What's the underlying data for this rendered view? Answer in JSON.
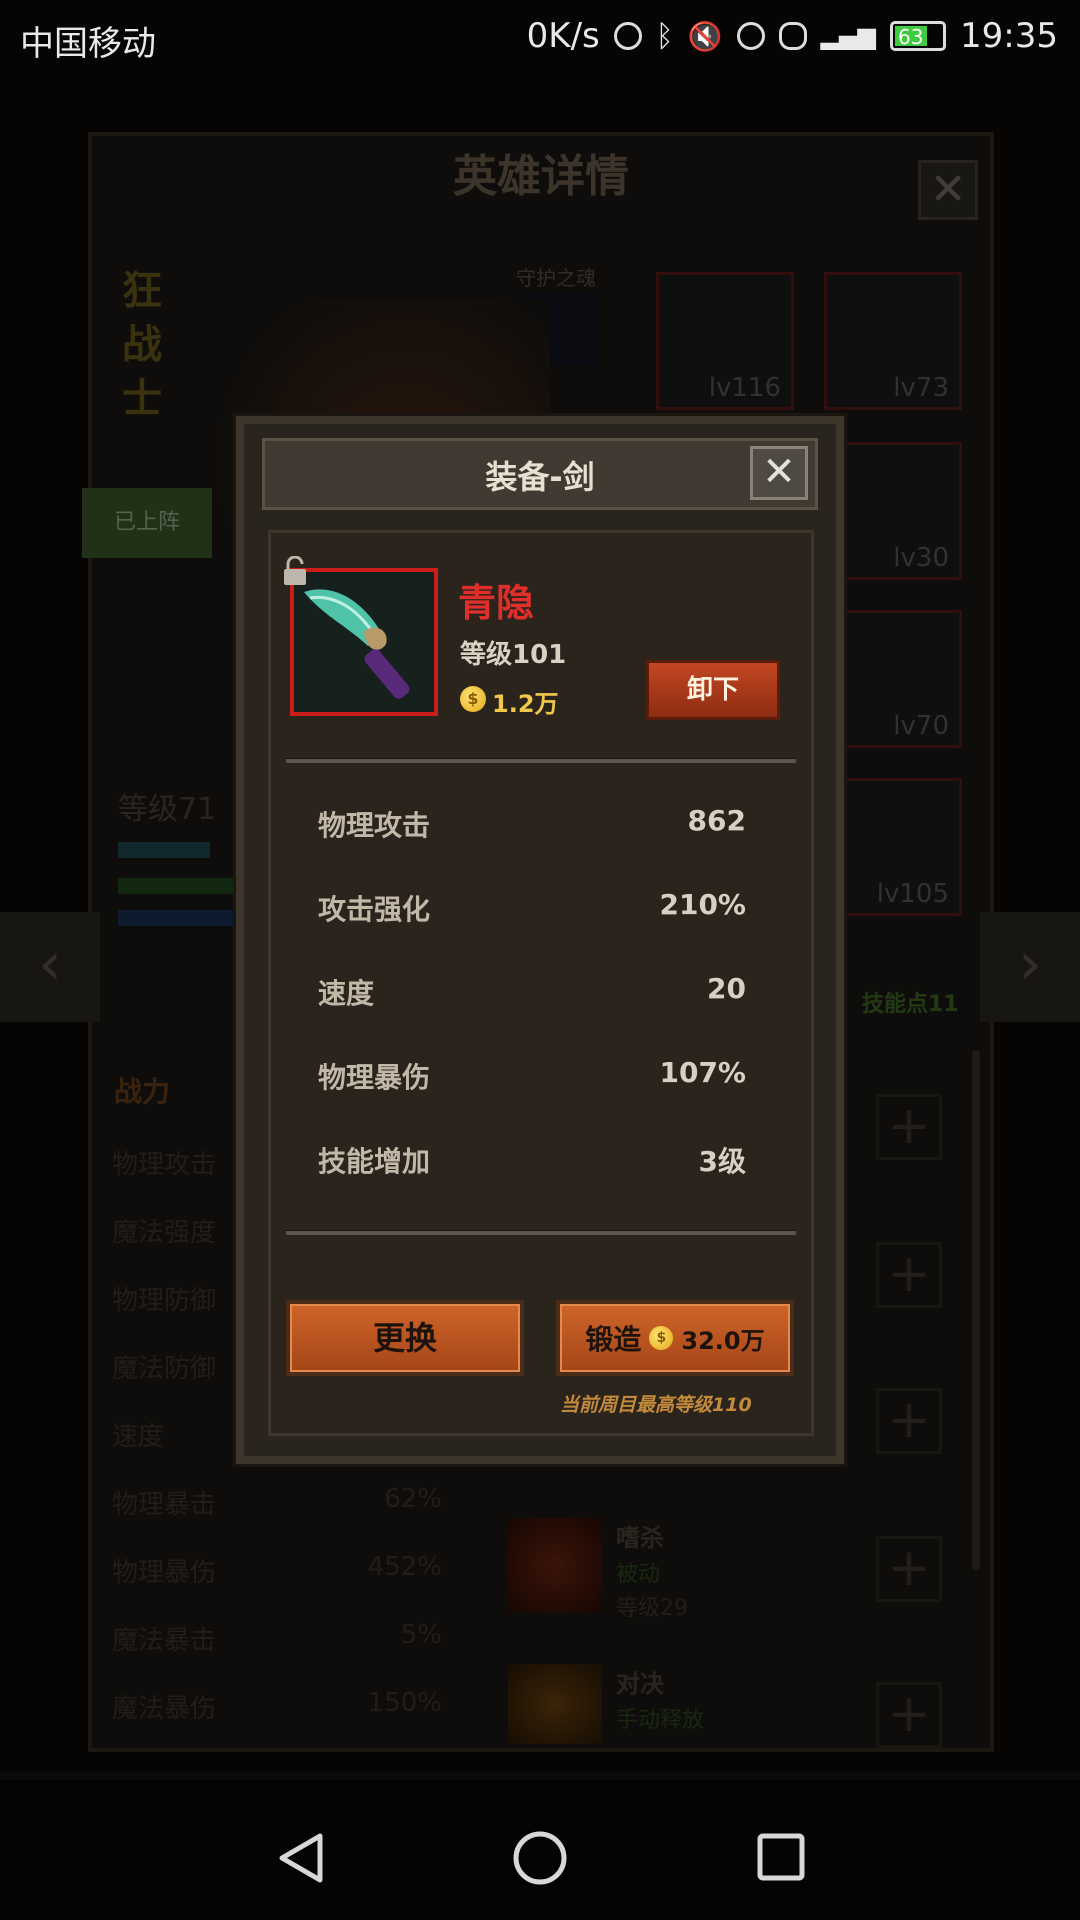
{
  "status_bar": {
    "carrier": "中国移动",
    "network_speed": "0K/s",
    "battery": "63",
    "time": "19:35"
  },
  "background": {
    "title": "英雄详情",
    "hero_name": "狂战士",
    "soul_label": "守护之魂",
    "deployed_badge": "已上阵",
    "hero_level": "等级71",
    "skill_points": "技能点11",
    "equipment_levels": [
      "lv116",
      "lv73",
      "lv30",
      "lv70",
      "lv105"
    ],
    "stats_title": "战力",
    "stats": [
      {
        "label": "物理攻击",
        "value": ""
      },
      {
        "label": "魔法强度",
        "value": ""
      },
      {
        "label": "物理防御",
        "value": ""
      },
      {
        "label": "魔法防御",
        "value": ""
      },
      {
        "label": "速度",
        "value": ""
      },
      {
        "label": "物理暴击",
        "value": "62%"
      },
      {
        "label": "物理暴伤",
        "value": "452%"
      },
      {
        "label": "魔法暴击",
        "value": "5%"
      },
      {
        "label": "魔法暴伤",
        "value": "150%"
      }
    ],
    "skills": [
      {
        "name": "嗜杀",
        "type": "被动",
        "level": "等级29"
      },
      {
        "name": "对决",
        "type": "手动释放",
        "level": ""
      }
    ]
  },
  "modal": {
    "title": "装备-剑",
    "close_label": "✕",
    "item": {
      "name": "青隐",
      "level": "等级101",
      "price": "1.2万"
    },
    "unequip_label": "卸下",
    "stats": [
      {
        "label": "物理攻击",
        "value": "862"
      },
      {
        "label": "攻击强化",
        "value": "210%"
      },
      {
        "label": "速度",
        "value": "20"
      },
      {
        "label": "物理暴伤",
        "value": "107%"
      },
      {
        "label": "技能增加",
        "value": "3级"
      }
    ],
    "replace_label": "更换",
    "forge_label": "锻造",
    "forge_cost": "32.0万",
    "max_level_note": "当前周目最高等级110"
  },
  "colors": {
    "item_name": "#e02e2a",
    "item_frame": "#cc1d1d",
    "button_orange": "#c55a25",
    "note_gold": "#c48a3c"
  }
}
